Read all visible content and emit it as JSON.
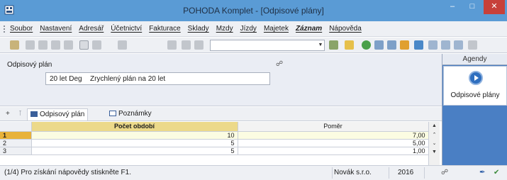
{
  "window": {
    "title": "POHODA Komplet - [Odpisové plány]",
    "minimize_icon": "minimize-icon",
    "maximize_icon": "maximize-icon",
    "close_icon": "close-icon",
    "close_color": "#c7403a",
    "titlebar_color": "#5a9bd5"
  },
  "menu": {
    "items": [
      "Soubor",
      "Nastavení",
      "Adresář",
      "Účetnictví",
      "Fakturace",
      "Sklady",
      "Mzdy",
      "Jízdy",
      "Majetek",
      "Záznam",
      "Nápověda"
    ]
  },
  "toolbar": {
    "filter_value": "",
    "icons": [
      "help-icon",
      "print-icon",
      "preview-icon",
      "export-icon",
      "new-icon",
      "edit-icon",
      "filter-icon",
      "save-icon",
      "copy-icon",
      "folder-icon",
      "plugin-icon",
      "calculator-icon",
      "ban-icon",
      "table-icon",
      "settings-icon"
    ]
  },
  "form": {
    "label": "Odpisový plán",
    "code": "20 let Deg",
    "name": "Zrychlený plán na 20 let",
    "attach_icon": "paperclip-icon"
  },
  "agendy": {
    "header": "Agendy",
    "item_label": "Odpisové plány",
    "item_icon": "play-circle-icon",
    "panel_color": "#4a7fc4"
  },
  "tabs": {
    "items": [
      {
        "label": "Odpisový plán",
        "icon": "table-icon",
        "active": true
      },
      {
        "label": "Poznámky",
        "icon": "notes-icon",
        "active": false
      }
    ]
  },
  "grid": {
    "columns": [
      "Počet období",
      "Poměr"
    ],
    "rows": [
      {
        "num": "1",
        "period": "10",
        "ratio": "7,00"
      },
      {
        "num": "2",
        "period": "5",
        "ratio": "5,00"
      },
      {
        "num": "3",
        "period": "5",
        "ratio": "1,00"
      }
    ],
    "header_color": "#ecd98a",
    "selected_row_color": "#e8b23a"
  },
  "status": {
    "message": "(1/4) Pro získání nápovědy stiskněte F1.",
    "company": "Novák s.r.o.",
    "year": "2016"
  }
}
